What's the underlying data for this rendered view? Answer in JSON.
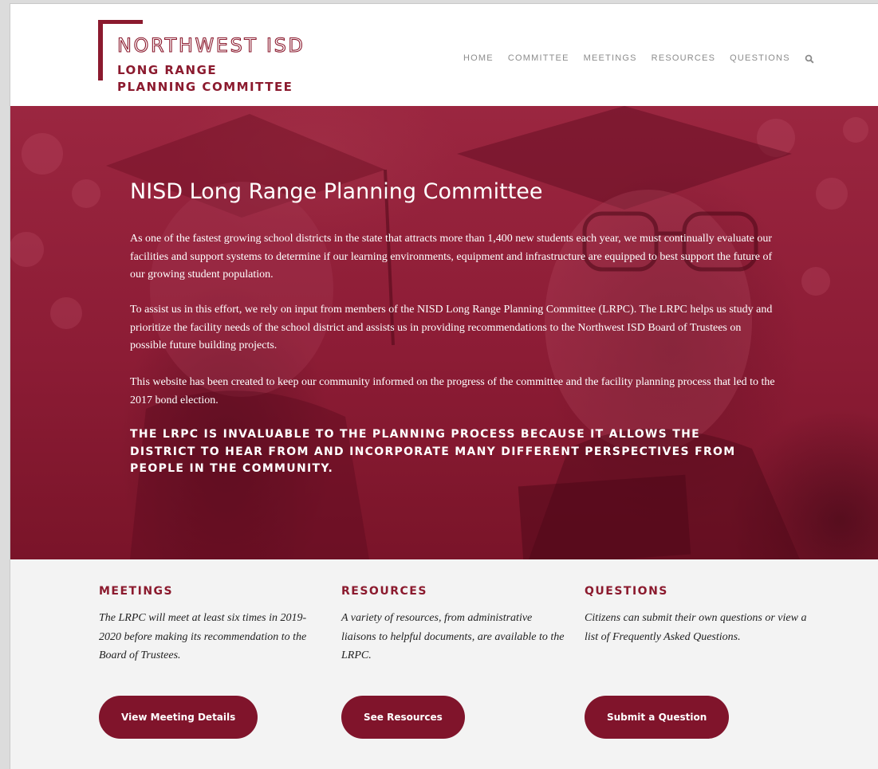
{
  "brand": {
    "logo_title": "NORTHWEST ISD",
    "logo_line1": "LONG RANGE",
    "logo_line2": "PLANNING COMMITTEE",
    "color": "#8b1a2e"
  },
  "nav": {
    "items": [
      {
        "label": "HOME"
      },
      {
        "label": "COMMITTEE"
      },
      {
        "label": "MEETINGS"
      },
      {
        "label": "RESOURCES"
      },
      {
        "label": "QUESTIONS"
      }
    ],
    "search_icon": "search-icon"
  },
  "hero": {
    "title": "NISD Long Range Planning Committee",
    "paragraphs": [
      "As one of the fastest growing school districts in the state that attracts more than 1,400 new students each year, we must continually evaluate our facilities and support systems to determine if our learning environments, equipment and infrastructure are equipped to best support the future of our growing student population.",
      "To assist us in this effort, we rely on input from members of the NISD Long Range Planning Committee (LRPC). The LRPC helps us study and prioritize the facility needs of the school district and assists us in providing recommendations to the Northwest ISD Board of Trustees on possible future building projects.",
      "This website has been created to keep our community informed on the progress of the committee and the facility planning process that led to the 2017 bond election."
    ],
    "callout": "THE LRPC IS INVALUABLE TO THE PLANNING PROCESS BECAUSE IT ALLOWS THE DISTRICT TO HEAR FROM AND INCORPORATE MANY DIFFERENT PERSPECTIVES FROM PEOPLE IN THE COMMUNITY.",
    "overlay_color": "#8c1c35"
  },
  "features": [
    {
      "heading": "MEETINGS",
      "text": "The LRPC will meet at least six times in 2019-2020 before making its recommendation to the Board of Trustees.",
      "button": "View Meeting Details"
    },
    {
      "heading": "RESOURCES",
      "text": "A variety of resources, from administrative liaisons to helpful documents, are available to the LRPC.",
      "button": "See Resources"
    },
    {
      "heading": "QUESTIONS",
      "text": "Citizens can submit their own questions or view a list of Frequently Asked Questions.",
      "button": "Submit a Question"
    }
  ]
}
